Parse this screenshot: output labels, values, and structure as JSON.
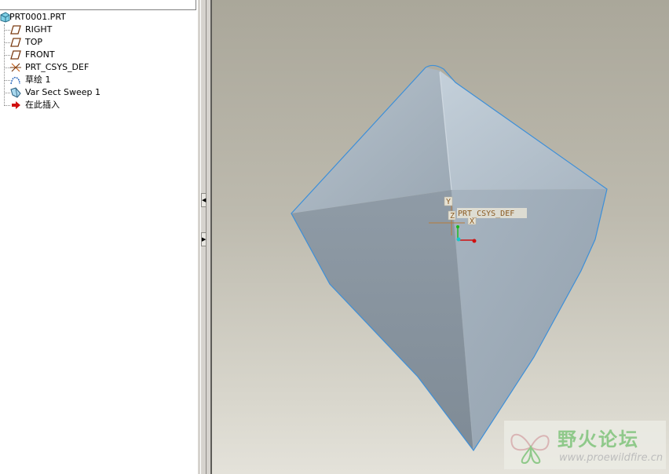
{
  "model_tree": {
    "root_label": "PRT0001.PRT",
    "items": [
      {
        "label": "RIGHT",
        "icon": "datum-plane-icon"
      },
      {
        "label": "TOP",
        "icon": "datum-plane-icon"
      },
      {
        "label": "FRONT",
        "icon": "datum-plane-icon"
      },
      {
        "label": "PRT_CSYS_DEF",
        "icon": "coordinate-system-icon"
      },
      {
        "label": "草绘 1",
        "icon": "sketch-icon"
      },
      {
        "label": "Var Sect Sweep 1",
        "icon": "var-sect-sweep-icon"
      },
      {
        "label": "在此插入",
        "icon": "insert-here-arrow-icon"
      }
    ]
  },
  "viewport": {
    "csys": {
      "label": "PRT_CSYS_DEF",
      "axis_x": "X",
      "axis_y": "Y",
      "axis_z": "Z"
    },
    "model_color": "#8e9ba8",
    "edge_color": "#3d8fd8"
  },
  "watermark": {
    "title": "野火论坛",
    "url": "www.proewildfire.cn"
  },
  "colors": {
    "viewport_top": "#aaa79a",
    "viewport_bottom": "#e4e2da",
    "accent_red": "#d01010"
  }
}
